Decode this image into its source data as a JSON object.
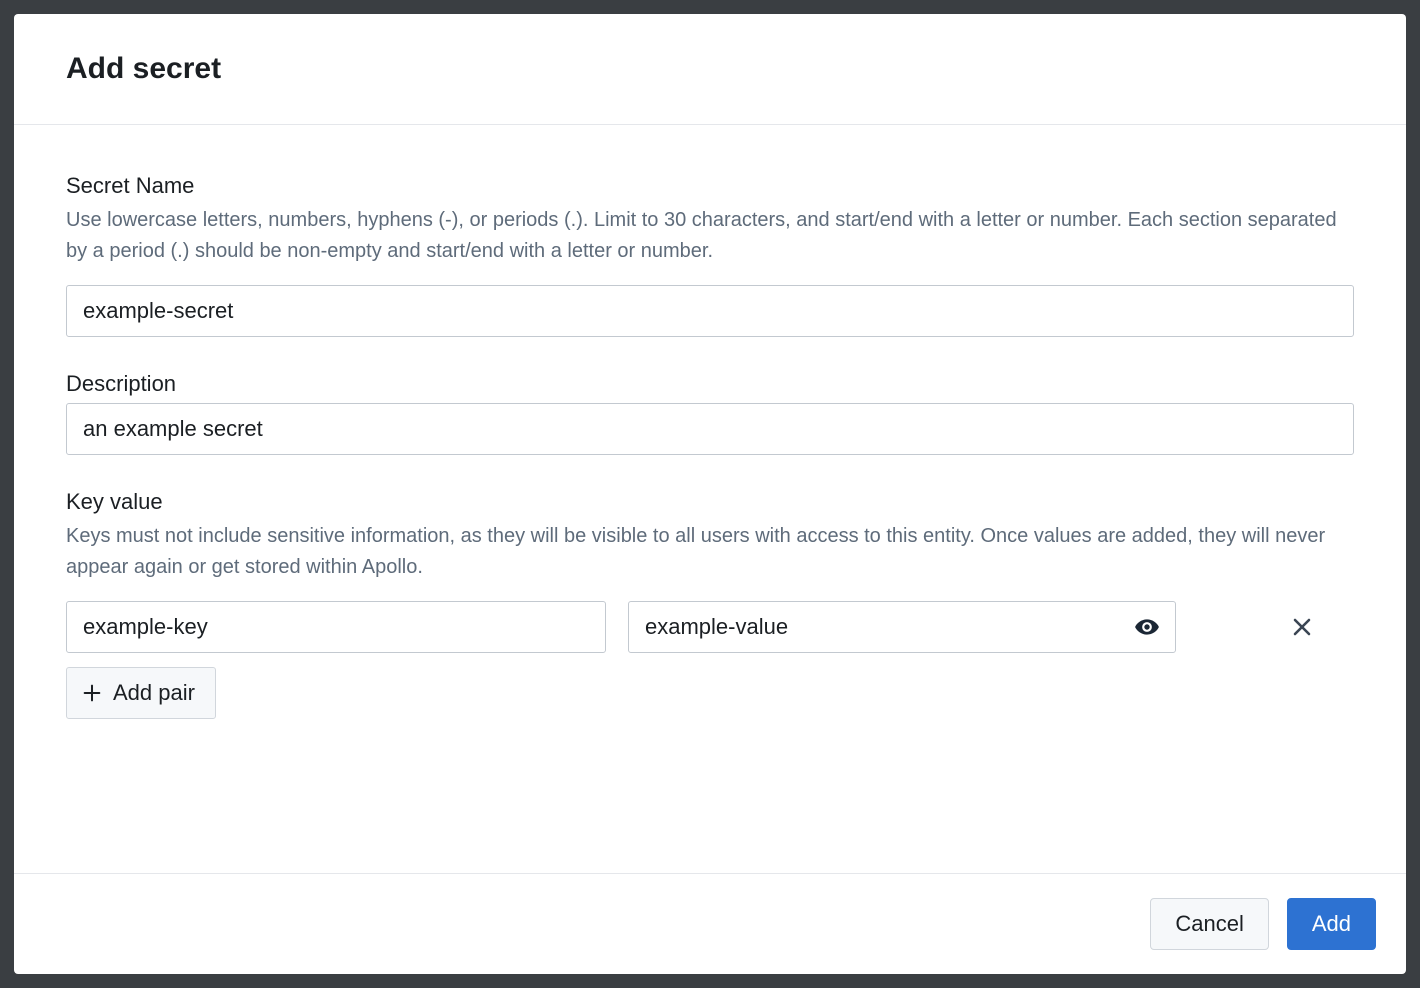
{
  "modal": {
    "title": "Add secret"
  },
  "secretName": {
    "label": "Secret Name",
    "hint": "Use lowercase letters, numbers, hyphens (-), or periods (.). Limit to 30 characters, and start/end with a letter or number. Each section separated by a period (.) should be non-empty and start/end with a letter or number.",
    "value": "example-secret"
  },
  "description": {
    "label": "Description",
    "value": "an example secret"
  },
  "keyValue": {
    "label": "Key value",
    "hint": "Keys must not include sensitive information, as they will be visible to all users with access to this entity. Once values are added, they will never appear again or get stored within Apollo.",
    "pairs": [
      {
        "key": "example-key",
        "value": "example-value"
      }
    ],
    "addPairLabel": "Add pair"
  },
  "footer": {
    "cancel": "Cancel",
    "add": "Add"
  }
}
